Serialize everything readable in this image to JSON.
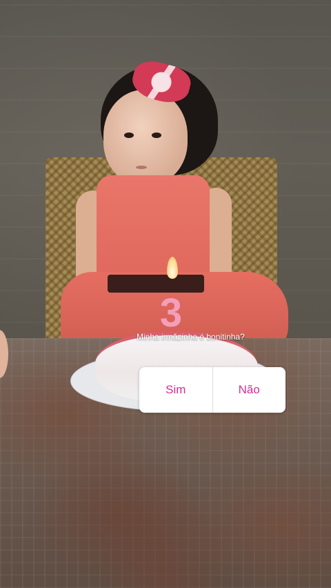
{
  "poll": {
    "question": "Minha irmãzinha é bonitinha?",
    "options": [
      "Sim",
      "Não"
    ],
    "option_color": "#d62d93"
  },
  "candle": {
    "number": "3"
  }
}
